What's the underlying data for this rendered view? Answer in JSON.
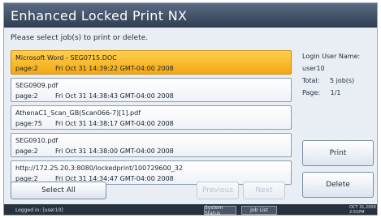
{
  "title": "Enhanced Locked Print NX",
  "instruction": "Please select job(s) to print or delete.",
  "jobs": [
    {
      "name": "Microsoft Word - SEG0715.DOC",
      "page": "page:2",
      "date": "Fri Oct 31 14:39:22 GMT-04:00 2008",
      "selected": true
    },
    {
      "name": "SEG0909.pdf",
      "page": "page:2",
      "date": "Fri Oct 31 14:38:43 GMT-04:00 2008",
      "selected": false
    },
    {
      "name": "AthenaC1_Scan_GB(Scan066-7)[1].pdf",
      "page": "page:75",
      "date": "Fri Oct 31 14:38:17 GMT-04:00 2008",
      "selected": false
    },
    {
      "name": "SEG0910.pdf",
      "page": "page:2",
      "date": "Fri Oct 31 14:38:00 GMT-04:00 2008",
      "selected": false
    },
    {
      "name": "http://172.25.20.3:8080/lockedprint/100729600_32",
      "page": "page:2",
      "date": "Fri Oct 31 14:34:47 GMT-04:00 2008",
      "selected": false
    }
  ],
  "info": {
    "login_label": "Login User Name:",
    "login_value": "user10",
    "total_label": "Total:",
    "total_value": "5 job(s)",
    "page_label": "Page:",
    "page_value": "1/1"
  },
  "buttons": {
    "print": "Print",
    "delete": "Delete",
    "select_all": "Select All",
    "previous": "Previous",
    "next": "Next"
  },
  "statusbar": {
    "logged_in": "Logged in: [user10]",
    "system_status": "System Status",
    "job_list": "Job List",
    "date": "OCT 31,2008",
    "time": "2:51PM"
  },
  "colors": {
    "title_bar": "#3f4e64",
    "selected_row": "#f9b82a",
    "background": "#e9eef4"
  }
}
